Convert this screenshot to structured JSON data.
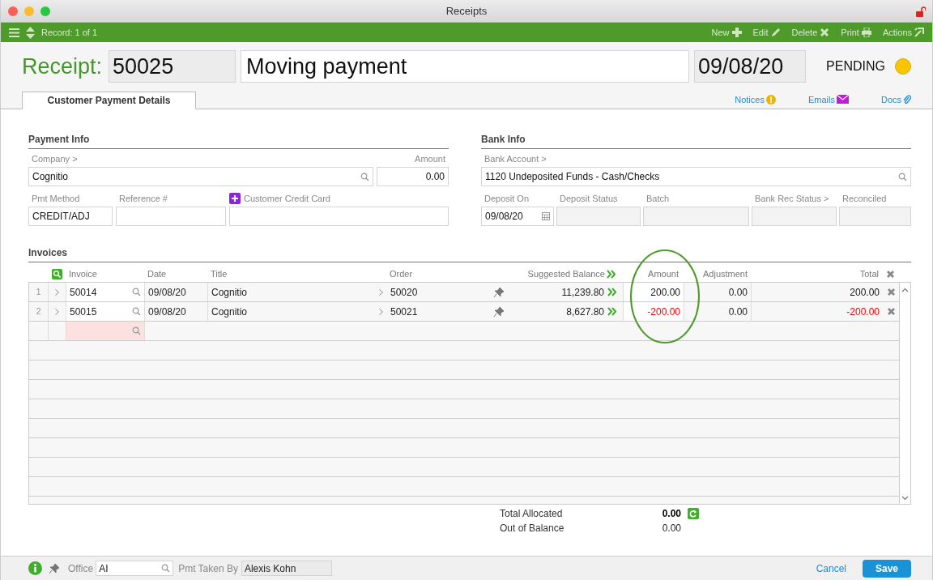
{
  "window": {
    "title": "Receipts"
  },
  "toolbar": {
    "record": "Record: 1 of 1",
    "actions": [
      {
        "label": "New",
        "kind": "new"
      },
      {
        "label": "Edit",
        "kind": "edit"
      },
      {
        "label": "Delete",
        "kind": "delete"
      },
      {
        "label": "Print",
        "kind": "print"
      },
      {
        "label": "Actions",
        "kind": "actions"
      }
    ]
  },
  "header": {
    "label": "Receipt:",
    "number": "50025",
    "description": "Moving payment",
    "date": "09/08/20",
    "status": "PENDING"
  },
  "tabs": [
    {
      "label": "Customer Payment Details",
      "selected": true
    }
  ],
  "links": [
    {
      "label": "Notices",
      "kind": "notices"
    },
    {
      "label": "Emails",
      "kind": "emails"
    },
    {
      "label": "Docs",
      "kind": "docs"
    }
  ],
  "payment_info": {
    "title": "Payment Info",
    "company": {
      "label": "Company >",
      "value": "Cognitio"
    },
    "amount": {
      "label": "Amount",
      "value": "0.00"
    },
    "pmt_method": {
      "label": "Pmt Method",
      "value": "CREDIT/ADJ"
    },
    "reference": {
      "label": "Reference #"
    },
    "credit_card": {
      "label": "Customer Credit Card"
    }
  },
  "bank_info": {
    "title": "Bank Info",
    "bank_account": {
      "label": "Bank Account >",
      "value": "1120 Undeposited Funds - Cash/Checks"
    },
    "fields": [
      {
        "label": "Deposit On",
        "value": "09/08/20",
        "kind": "date"
      },
      {
        "label": "Deposit Status",
        "kind": "readonly"
      },
      {
        "label": "Batch",
        "kind": "readonly"
      },
      {
        "label": "Bank Rec Status >",
        "kind": "readonly"
      },
      {
        "label": "Reconciled",
        "kind": "readonly"
      }
    ]
  },
  "invoices": {
    "title": "Invoices",
    "columns": [
      "Invoice",
      "Date",
      "Title",
      "Order",
      "Suggested Balance",
      "Amount",
      "Adjustment",
      "Total"
    ],
    "rows": [
      {
        "number": "1",
        "invoice": "50014",
        "date": "09/08/20",
        "title": "Cognitio",
        "order": "50020",
        "suggested_balance": "11,239.80",
        "amount": "200.00",
        "adjustment": "0.00",
        "total": "200.00",
        "negative": false
      },
      {
        "number": "2",
        "invoice": "50015",
        "date": "09/08/20",
        "title": "Cognitio",
        "order": "50021",
        "suggested_balance": "8,627.80",
        "amount": "-200.00",
        "adjustment": "0.00",
        "total": "-200.00",
        "negative": true
      }
    ]
  },
  "totals": [
    {
      "label": "Total Allocated",
      "value": "0.00",
      "bold": true
    },
    {
      "label": "Out of Balance",
      "value": "0.00",
      "bold": false
    }
  ],
  "footer": {
    "office": {
      "label": "Office",
      "value": "AI"
    },
    "taken_by": {
      "label": "Pmt Taken By",
      "value": "Alexis Kohn"
    },
    "buttons": [
      {
        "label": "Cancel",
        "kind": "link"
      },
      {
        "label": "Save",
        "kind": "primary"
      }
    ]
  }
}
